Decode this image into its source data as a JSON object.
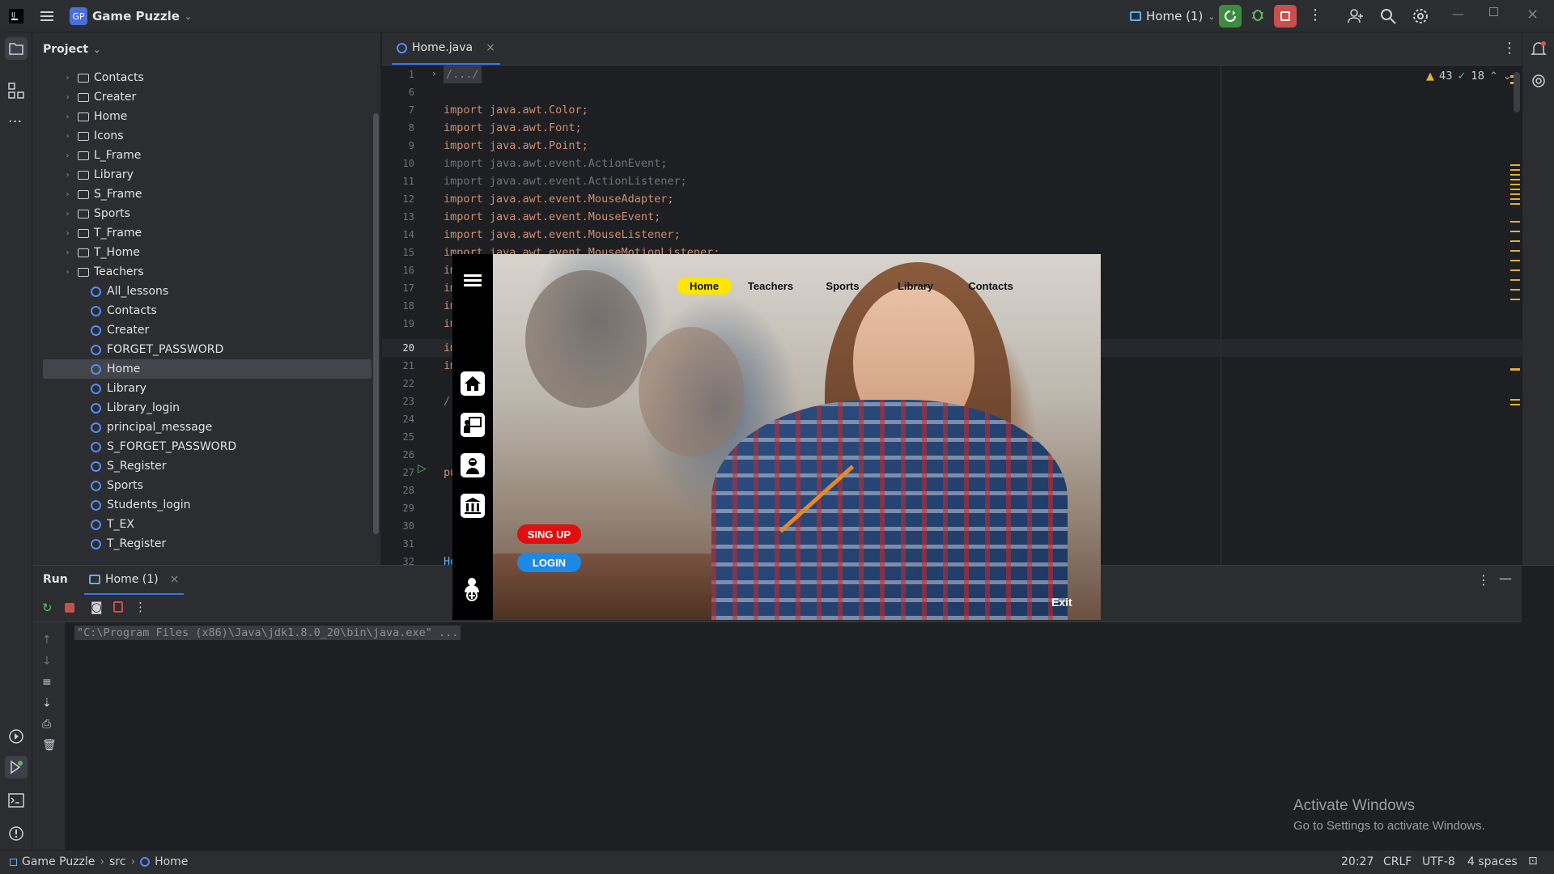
{
  "titlebar": {
    "app_badge": "GP",
    "project_name": "Game Puzzle",
    "run_config": "Home (1)"
  },
  "project_panel": {
    "title": "Project",
    "folders": [
      "Contacts",
      "Creater",
      "Home",
      "Icons",
      "L_Frame",
      "Library",
      "S_Frame",
      "Sports",
      "T_Frame",
      "T_Home",
      "Teachers"
    ],
    "classes": [
      "All_lessons",
      "Contacts",
      "Creater",
      "FORGET_PASSWORD",
      "Home",
      "Library",
      "Library_login",
      "principal_message",
      "S_FORGET_PASSWORD",
      "S_Register",
      "Sports",
      "Students_login",
      "T_EX",
      "T_Register"
    ],
    "selected": "Home"
  },
  "editor": {
    "tab_label": "Home.java",
    "inspections": {
      "warnings": "43",
      "ok": "18"
    },
    "lines": [
      {
        "n": "1",
        "code": "/.../"
      },
      {
        "n": "6",
        "code": ""
      },
      {
        "n": "7",
        "code": "import java.awt.Color;"
      },
      {
        "n": "8",
        "code": "import java.awt.Font;"
      },
      {
        "n": "9",
        "code": "import java.awt.Point;"
      },
      {
        "n": "10",
        "code": "import java.awt.event.ActionEvent;"
      },
      {
        "n": "11",
        "code": "import java.awt.event.ActionListener;"
      },
      {
        "n": "12",
        "code": "import java.awt.event.MouseAdapter;"
      },
      {
        "n": "13",
        "code": "import java.awt.event.MouseEvent;"
      },
      {
        "n": "14",
        "code": "import java.awt.event.MouseListener;"
      },
      {
        "n": "15",
        "code": "import java.awt.event.MouseMotionListener;"
      },
      {
        "n": "16",
        "code": "im"
      },
      {
        "n": "17",
        "code": "im"
      },
      {
        "n": "18",
        "code": "im"
      },
      {
        "n": "19",
        "code": "im"
      },
      {
        "n": "20",
        "code": "im"
      },
      {
        "n": "21",
        "code": "im"
      },
      {
        "n": "22",
        "code": ""
      },
      {
        "n": "23",
        "code": "/"
      },
      {
        "n": "24",
        "code": " "
      },
      {
        "n": "25",
        "code": " "
      },
      {
        "n": "26",
        "code": " "
      },
      {
        "n": "27",
        "code": "pu"
      },
      {
        "n": "28",
        "code": ""
      },
      {
        "n": "29",
        "code": ""
      },
      {
        "n": "30",
        "code": ""
      },
      {
        "n": "31",
        "code": ""
      },
      {
        "n": "32",
        "code": "Ho"
      }
    ]
  },
  "run_panel": {
    "title": "Run",
    "tab_label": "Home (1)",
    "command": "\"C:\\Program Files (x86)\\Java\\jdk1.8.0_20\\bin\\java.exe\" ..."
  },
  "swing_app": {
    "nav": [
      "Home",
      "Teachers",
      "Sports",
      "Library",
      "Contacts"
    ],
    "active_nav": "Home",
    "signup_label": "SING UP",
    "login_label": "LOGIN",
    "exit_label": "Exit",
    "colors": {
      "active_nav": "#ffe500",
      "signup": "#e01010",
      "login": "#1e88e5"
    }
  },
  "watermark": {
    "title": "Activate Windows",
    "subtitle": "Go to Settings to activate Windows."
  },
  "statusbar": {
    "breadcrumb": [
      "Game Puzzle",
      "src",
      "Home"
    ],
    "position": "20:27",
    "line_ending": "CRLF",
    "encoding": "UTF-8",
    "indent": "4 spaces"
  }
}
